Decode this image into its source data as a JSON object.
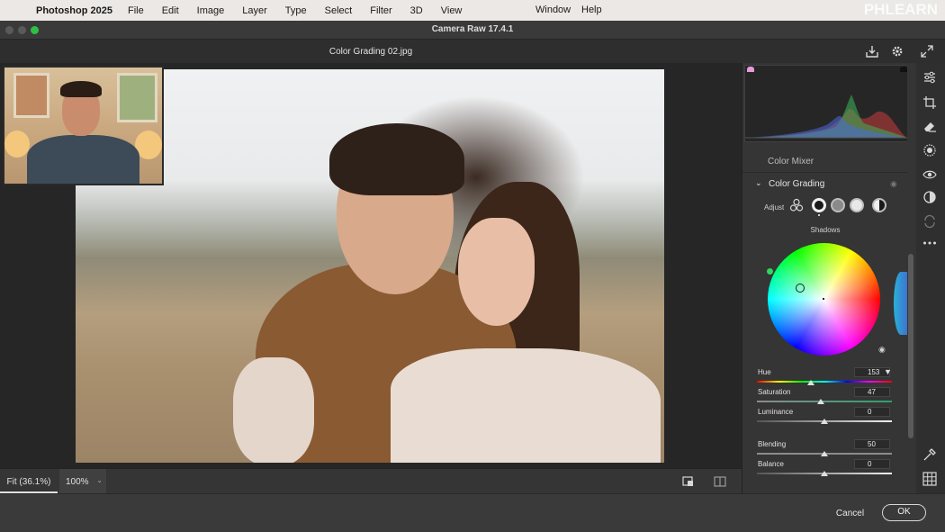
{
  "menubar": {
    "app": "Photoshop 2025",
    "items": [
      "File",
      "Edit",
      "Image",
      "Layer",
      "Type",
      "Select",
      "Filter",
      "3D",
      "View"
    ],
    "window": "Window",
    "help": "Help",
    "watermark": "PHLEARN"
  },
  "dialog": {
    "title": "Camera Raw 17.4.1",
    "filename": "Color Grading 02.jpg"
  },
  "bottom": {
    "fit_label": "Fit (36.1%)",
    "zoom_value": "100%"
  },
  "panel": {
    "color_mixer_label": "Color Mixer",
    "color_grading_label": "Color Grading",
    "adjust_label": "Adjust",
    "wheel_label": "Shadows",
    "sliders": [
      {
        "label": "Hue",
        "value": "153",
        "level": 0.4
      },
      {
        "label": "Saturation",
        "value": "47",
        "level": 0.47
      },
      {
        "label": "Luminance",
        "value": "0",
        "level": 0.5
      },
      {
        "label": "Blending",
        "value": "50",
        "level": 0.5
      },
      {
        "label": "Balance",
        "value": "0",
        "level": 0.5
      }
    ]
  },
  "footer": {
    "cancel": "Cancel",
    "ok": "OK"
  },
  "icons": [
    "apple-icon",
    "export-icon",
    "settings-icon",
    "fullscreen-icon",
    "edit-sliders-icon",
    "crop-icon",
    "eraser-icon",
    "mask-icon",
    "redeye-icon",
    "presets-icon",
    "snapshot-icon",
    "more-icon",
    "eyedropper-icon",
    "grid-icon",
    "eye-icon"
  ],
  "colors": {
    "shadow_indicator": "#2fd55e",
    "accent": "#e0e0e0"
  }
}
